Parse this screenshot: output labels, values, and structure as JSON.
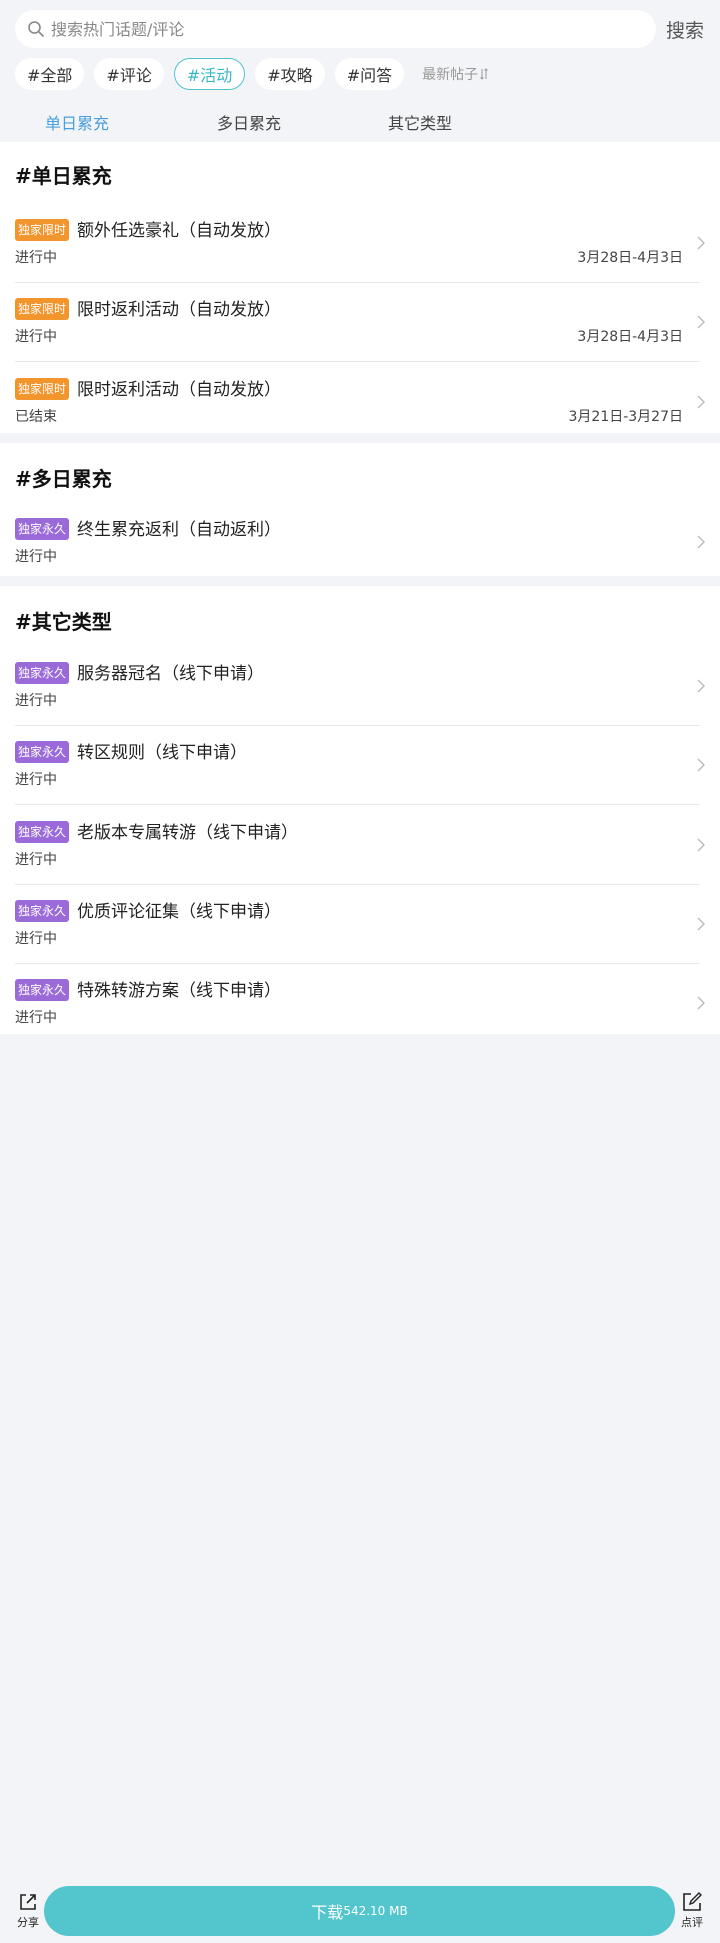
{
  "search": {
    "placeholder": "搜索热门话题/评论",
    "button_label": "搜索"
  },
  "filters": [
    {
      "label": "#全部",
      "active": false
    },
    {
      "label": "#评论",
      "active": false
    },
    {
      "label": "#活动",
      "active": true
    },
    {
      "label": "#攻略",
      "active": false
    },
    {
      "label": "#问答",
      "active": false
    }
  ],
  "sort_label": "最新帖子",
  "tabs": [
    {
      "label": "单日累充",
      "active": true
    },
    {
      "label": "多日累充",
      "active": false
    },
    {
      "label": "其它类型",
      "active": false
    }
  ],
  "sections": [
    {
      "title": "#单日累充",
      "items": [
        {
          "badge": "独家限时",
          "badge_color": "#f2952c",
          "title": "额外任选豪礼（自动发放）",
          "status": "进行中",
          "date": "3月28日-4月3日"
        },
        {
          "badge": "独家限时",
          "badge_color": "#f2952c",
          "title": "限时返利活动（自动发放）",
          "status": "进行中",
          "date": "3月28日-4月3日"
        },
        {
          "badge": "独家限时",
          "badge_color": "#f2952c",
          "title": "限时返利活动（自动发放）",
          "status": "已结束",
          "date": "3月21日-3月27日"
        }
      ]
    },
    {
      "title": "#多日累充",
      "items": [
        {
          "badge": "独家永久",
          "badge_color": "#9b6ad9",
          "title": "终生累充返利（自动返利）",
          "status": "进行中",
          "date": ""
        }
      ]
    },
    {
      "title": "#其它类型",
      "items": [
        {
          "badge": "独家永久",
          "badge_color": "#9b6ad9",
          "title": "服务器冠名（线下申请）",
          "status": "进行中",
          "date": ""
        },
        {
          "badge": "独家永久",
          "badge_color": "#9b6ad9",
          "title": "转区规则（线下申请）",
          "status": "进行中",
          "date": ""
        },
        {
          "badge": "独家永久",
          "badge_color": "#9b6ad9",
          "title": "老版本专属转游（线下申请）",
          "status": "进行中",
          "date": ""
        },
        {
          "badge": "独家永久",
          "badge_color": "#9b6ad9",
          "title": "优质评论征集（线下申请）",
          "status": "进行中",
          "date": ""
        },
        {
          "badge": "独家永久",
          "badge_color": "#9b6ad9",
          "title": "特殊转游方案（线下申请）",
          "status": "进行中",
          "date": ""
        }
      ]
    }
  ],
  "bottom": {
    "share_label": "分享",
    "review_label": "点评",
    "download_label": "下载",
    "download_size": "542.10 MB"
  },
  "colors": {
    "accent": "#52c5cd",
    "active_tab": "#4a9fe0",
    "badge_limited": "#f2952c",
    "badge_permanent": "#9b6ad9"
  },
  "icons": {
    "search": "search-icon",
    "sort": "sort-icon",
    "chevron": "chevron-right-icon",
    "share": "share-icon",
    "review": "edit-icon"
  }
}
